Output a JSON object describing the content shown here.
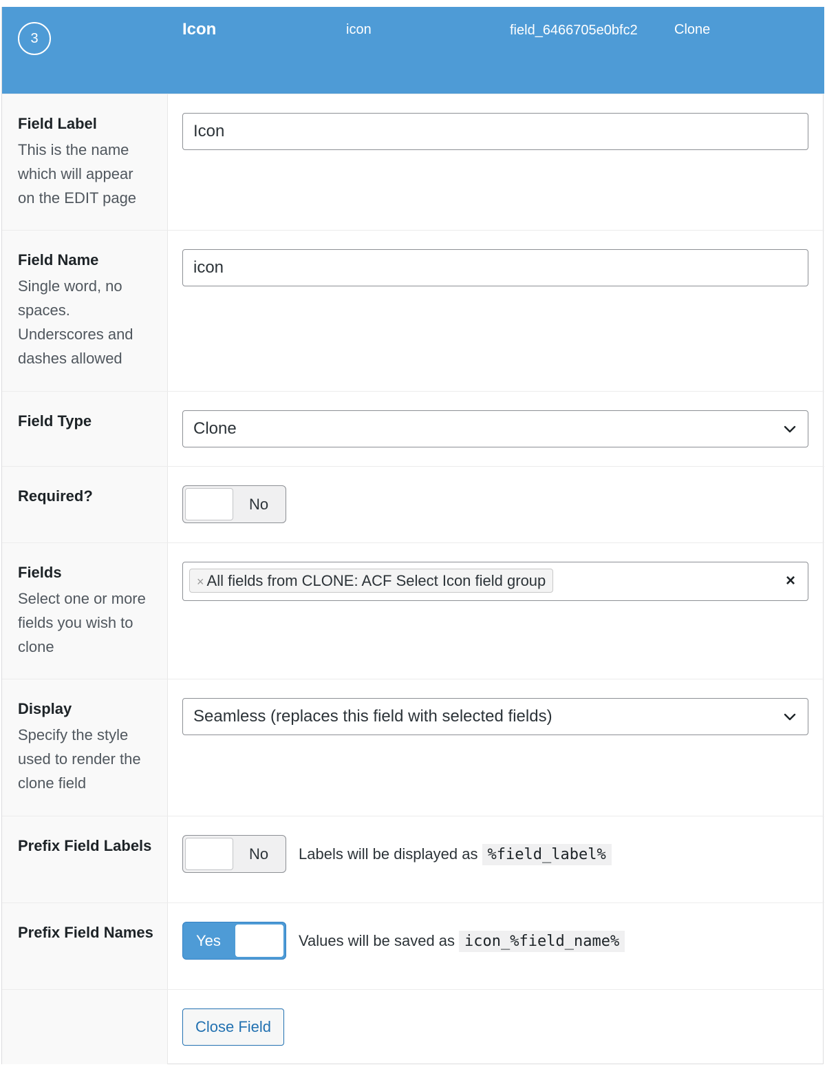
{
  "header": {
    "order": "3",
    "label": "Icon",
    "name": "icon",
    "key": "field_6466705e0bfc2",
    "type": "Clone",
    "bg_color": "#4e9bd6"
  },
  "fields": {
    "field_label": {
      "label": "Field Label",
      "description": "This is the name which will appear on the EDIT page",
      "value": "Icon"
    },
    "field_name": {
      "label": "Field Name",
      "description": "Single word, no spaces. Underscores and dashes allowed",
      "value": "icon"
    },
    "field_type": {
      "label": "Field Type",
      "value": "Clone",
      "icon": "chevron-down-icon"
    },
    "required": {
      "label": "Required?",
      "state_label": "No",
      "checked": false
    },
    "clone_fields": {
      "label": "Fields",
      "description": "Select one or more fields you wish to clone",
      "chip_remove": "×",
      "chip_text": "All fields from CLONE: ACF Select Icon field group",
      "clear": "×"
    },
    "display": {
      "label": "Display",
      "description": "Specify the style used to render the clone field",
      "value": "Seamless (replaces this field with selected fields)",
      "icon": "chevron-down-icon"
    },
    "prefix_labels": {
      "label": "Prefix Field Labels",
      "state_label": "No",
      "checked": false,
      "hint": "Labels will be displayed as",
      "code": "%field_label%"
    },
    "prefix_names": {
      "label": "Prefix Field Names",
      "state_label": "Yes",
      "checked": true,
      "hint": "Values will be saved as",
      "code": "icon_%field_name%"
    }
  },
  "actions": {
    "close_label": "Close Field"
  }
}
